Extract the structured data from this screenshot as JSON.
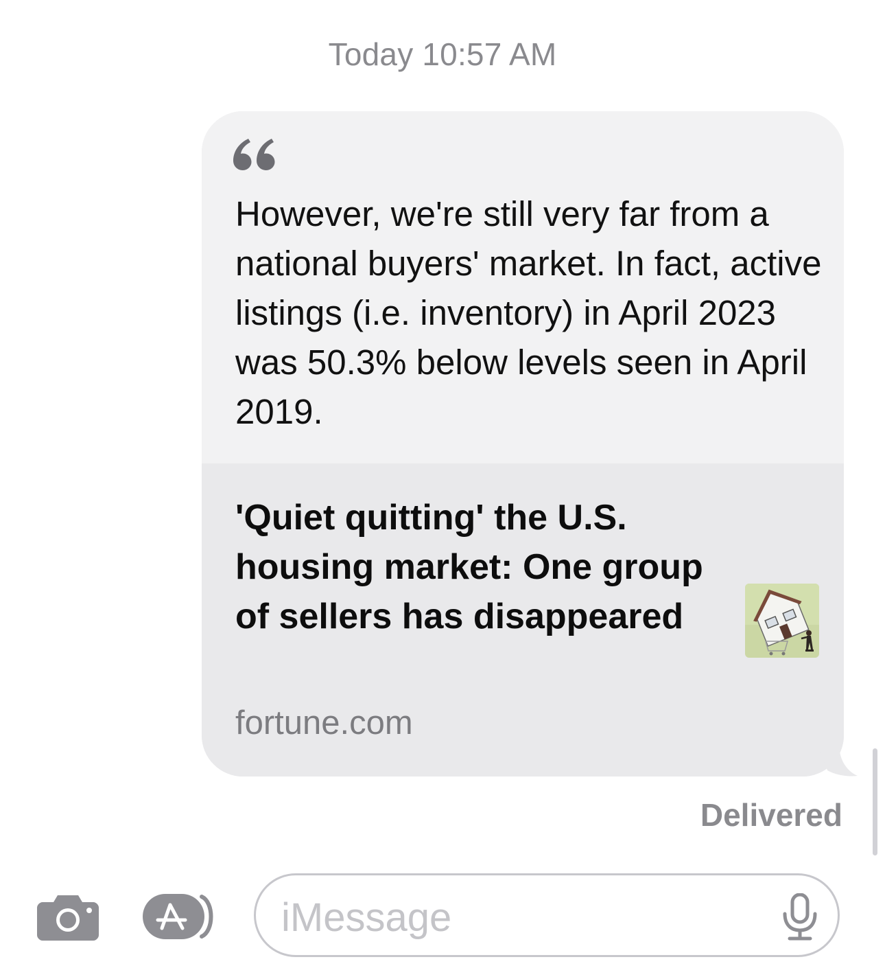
{
  "header": {
    "timestamp": "Today 10:57 AM"
  },
  "message": {
    "quote_icon": "quote-mark-icon",
    "quote_text": "However, we're still very far from a national buyers' market. In fact, active listings (i.e. inventory) in April 2023 was 50.3% below levels seen in April 2019.",
    "link_title": "'Quiet quitting' the U.S. housing market: One group of sellers has disappeared",
    "link_domain": "fortune.com",
    "thumbnail_icon": "house-thumbnail",
    "status": "Delivered"
  },
  "input_bar": {
    "camera_icon": "camera-icon",
    "apps_icon": "app-store-icon",
    "placeholder": "iMessage",
    "mic_icon": "microphone-icon"
  },
  "colors": {
    "bubble_bg": "#e9e9eb",
    "quote_bg": "#f2f2f3",
    "secondary_text": "#8a8a8e",
    "icon_gray": "#8e8e93"
  }
}
